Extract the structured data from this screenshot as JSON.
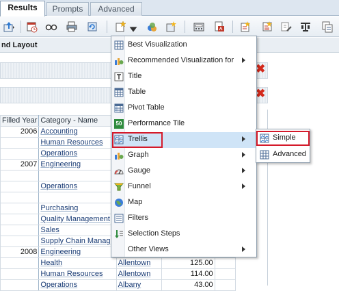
{
  "tabs": [
    {
      "label": "Results",
      "active": true
    },
    {
      "label": "Prompts",
      "active": false
    },
    {
      "label": "Advanced",
      "active": false
    }
  ],
  "toolbar_icons": [
    "export-icon",
    "schedule-icon",
    "preview-icon",
    "print-icon",
    "refresh-icon",
    "new-view-icon",
    "view-properties-icon",
    "new-view-alt-icon",
    "calculator-icon",
    "pdf-icon",
    "filter-icon",
    "report-icon",
    "edit-icon",
    "column-icon",
    "duplicate-icon"
  ],
  "layout_header": "nd Layout",
  "table": {
    "headers": {
      "year": "Filled Year",
      "category": "Category - Name"
    },
    "rows": [
      {
        "year": "2006",
        "category": "Accounting",
        "city": "",
        "value": ""
      },
      {
        "year": "",
        "category": "Human Resources",
        "city": "",
        "value": ""
      },
      {
        "year": "",
        "category": "Operations",
        "city": "",
        "value": ""
      },
      {
        "year": "2007",
        "category": "Engineering",
        "city": "",
        "value": ""
      },
      {
        "year": "",
        "category": "",
        "city": "",
        "value": ""
      },
      {
        "year": "",
        "category": "Operations",
        "city": "",
        "value": ""
      },
      {
        "year": "",
        "category": "",
        "city": "",
        "value": ""
      },
      {
        "year": "",
        "category": "Purchasing",
        "city": "",
        "value": ""
      },
      {
        "year": "",
        "category": "Quality Management",
        "city": "",
        "value": ""
      },
      {
        "year": "",
        "category": "Sales",
        "city": "",
        "value": ""
      },
      {
        "year": "",
        "category": "Supply Chain Manage",
        "city": "",
        "value": ""
      },
      {
        "year": "2008",
        "category": "Engineering",
        "city": "",
        "value": ""
      },
      {
        "year": "",
        "category": "Health",
        "city": "Allentown",
        "value": "125.00"
      },
      {
        "year": "",
        "category": "Human Resources",
        "city": "Allentown",
        "value": "114.00"
      },
      {
        "year": "",
        "category": "Operations",
        "city": "Albany",
        "value": "43.00"
      }
    ]
  },
  "menu": {
    "items": [
      {
        "label": "Best Visualization",
        "icon": "best-visualization-icon",
        "submenu": false
      },
      {
        "label": "Recommended Visualization for",
        "icon": "recommended-visualization-icon",
        "submenu": true
      },
      {
        "label": "Title",
        "icon": "title-icon",
        "submenu": false
      },
      {
        "label": "Table",
        "icon": "table-icon",
        "submenu": false
      },
      {
        "label": "Pivot Table",
        "icon": "pivot-table-icon",
        "submenu": false
      },
      {
        "label": "Performance Tile",
        "icon": "performance-tile-icon",
        "submenu": false
      },
      {
        "label": "Trellis",
        "icon": "trellis-icon",
        "submenu": true
      },
      {
        "label": "Graph",
        "icon": "graph-icon",
        "submenu": true
      },
      {
        "label": "Gauge",
        "icon": "gauge-icon",
        "submenu": true
      },
      {
        "label": "Funnel",
        "icon": "funnel-icon",
        "submenu": true
      },
      {
        "label": "Map",
        "icon": "map-icon",
        "submenu": false
      },
      {
        "label": "Filters",
        "icon": "filters-icon",
        "submenu": false
      },
      {
        "label": "Selection Steps",
        "icon": "selection-steps-icon",
        "submenu": false
      },
      {
        "label": "Other Views",
        "icon": "",
        "submenu": true
      }
    ],
    "performance_tile_badge": "50"
  },
  "submenu": {
    "items": [
      {
        "label": "Simple",
        "icon": "simple-trellis-icon"
      },
      {
        "label": "Advanced",
        "icon": "advanced-trellis-icon"
      }
    ]
  },
  "colors": {
    "highlight": "#cfe4f7",
    "callout": "#d51a2a",
    "link": "#1b3d76"
  }
}
